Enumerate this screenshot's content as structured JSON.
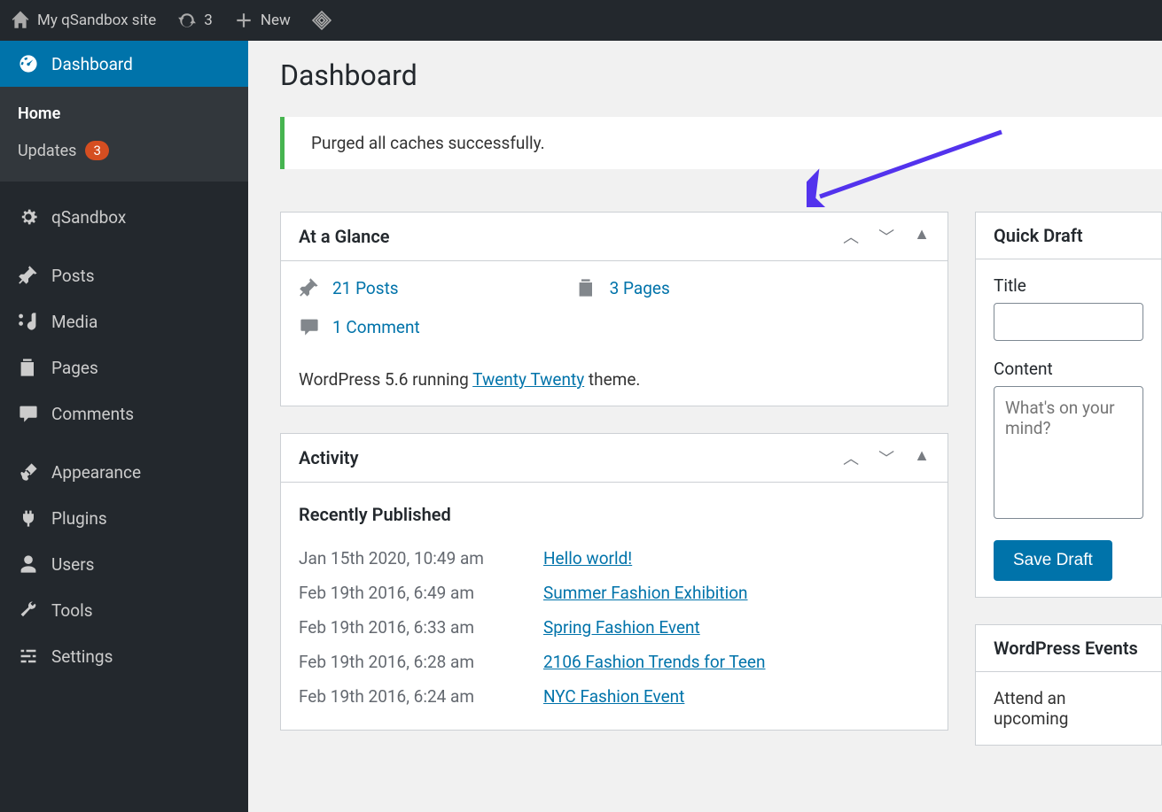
{
  "topbar": {
    "site_name": "My qSandbox site",
    "updates_count": "3",
    "new_label": "New"
  },
  "sidebar": {
    "dashboard": "Dashboard",
    "home": "Home",
    "updates": "Updates",
    "updates_badge": "3",
    "qsandbox": "qSandbox",
    "posts": "Posts",
    "media": "Media",
    "pages": "Pages",
    "comments": "Comments",
    "appearance": "Appearance",
    "plugins": "Plugins",
    "users": "Users",
    "tools": "Tools",
    "settings": "Settings"
  },
  "page_title": "Dashboard",
  "notice_text": "Purged all caches successfully.",
  "glance": {
    "title": "At a Glance",
    "posts": "21 Posts",
    "pages": "3 Pages",
    "comments": "1 Comment",
    "wp_prefix": "WordPress 5.6 running ",
    "theme": "Twenty Twenty",
    "wp_suffix": " theme."
  },
  "activity": {
    "title": "Activity",
    "recently_published": "Recently Published",
    "items": [
      {
        "date": "Jan 15th 2020, 10:49 am",
        "title": "Hello world!"
      },
      {
        "date": "Feb 19th 2016, 6:49 am",
        "title": "Summer Fashion Exhibition"
      },
      {
        "date": "Feb 19th 2016, 6:33 am",
        "title": "Spring Fashion Event"
      },
      {
        "date": "Feb 19th 2016, 6:28 am",
        "title": "2106 Fashion Trends for Teen"
      },
      {
        "date": "Feb 19th 2016, 6:24 am",
        "title": "NYC Fashion Event"
      }
    ]
  },
  "quick_draft": {
    "title": "Quick Draft",
    "title_label": "Title",
    "content_label": "Content",
    "content_placeholder": "What's on your mind?",
    "save_label": "Save Draft"
  },
  "events": {
    "title": "WordPress Events",
    "text": "Attend an upcoming"
  }
}
